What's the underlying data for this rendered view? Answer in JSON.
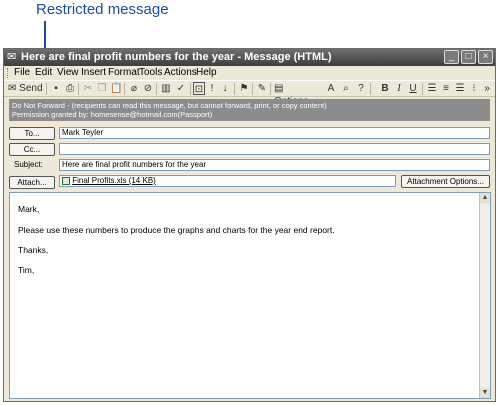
{
  "callout": {
    "label": "Restricted message"
  },
  "window": {
    "title": "Here are final profit numbers for the year - Message (HTML)",
    "controls": {
      "minimize": "_",
      "maximize": "□",
      "close": "×"
    }
  },
  "menu": [
    "File",
    "Edit",
    "View",
    "Insert",
    "Format",
    "Tools",
    "Actions",
    "Help"
  ],
  "toolbar": {
    "send_label": "Send",
    "options_label": "Options...",
    "bold": "B",
    "italic": "I",
    "underline": "U"
  },
  "info_bar": {
    "line1": "Do Not Forward - (recipients can read this message, but cannot forward, print, or copy content)",
    "line2": "Permission granted by: homesense@hotmail.com(Passport)"
  },
  "header": {
    "to_button": "To...",
    "to_value": "Mark Teyler",
    "cc_button": "Cc...",
    "cc_value": "",
    "subject_label": "Subject:",
    "subject_value": "Here are final profit numbers for the year",
    "attach_button": "Attach...",
    "attachment": "Final Profits.xls (14 KB)",
    "attachment_options_button": "Attachment Options..."
  },
  "body": {
    "greeting": "Mark,",
    "paragraph": "Please use these numbers to produce the graphs and charts for the year end report.",
    "closing": "Thanks,",
    "signature": "Tim,"
  },
  "icons": {
    "window_icon": "envelope-icon",
    "attachment_icon": "excel-file-icon"
  }
}
